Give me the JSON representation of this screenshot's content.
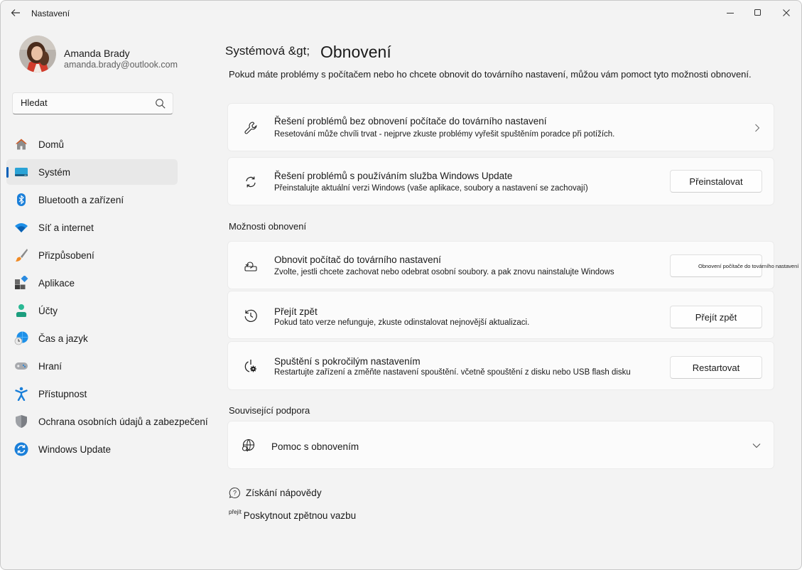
{
  "window": {
    "title": "Nastavení",
    "controls": {
      "minimize": "minimize-icon",
      "maximize": "maximize-icon",
      "close": "close-icon"
    }
  },
  "profile": {
    "name": "Amanda Brady",
    "email": "amanda.brady@outlook.com"
  },
  "search": {
    "placeholder": "Hledat",
    "value": ""
  },
  "sidebar": {
    "items": [
      {
        "label": "Domů",
        "icon": "home-icon",
        "active": false
      },
      {
        "label": "Systém",
        "icon": "system-icon",
        "active": true
      },
      {
        "label": "Bluetooth a zařízení",
        "icon": "bluetooth-icon",
        "active": false
      },
      {
        "label": "Síť a internet",
        "icon": "wifi-icon",
        "active": false
      },
      {
        "label": "Přizpůsobení",
        "icon": "brush-icon",
        "active": false
      },
      {
        "label": "Aplikace",
        "icon": "apps-icon",
        "active": false
      },
      {
        "label": "Účty",
        "icon": "account-icon",
        "active": false
      },
      {
        "label": "Čas a jazyk",
        "icon": "time-language-icon",
        "active": false
      },
      {
        "label": "Hraní",
        "icon": "gaming-icon",
        "active": false
      },
      {
        "label": "Přístupnost",
        "icon": "accessibility-icon",
        "active": false
      },
      {
        "label": "Ochrana osobních údajů a zabezpečení",
        "icon": "shield-icon",
        "active": false
      },
      {
        "label": "Windows Update",
        "icon": "windows-update-icon",
        "active": false
      }
    ]
  },
  "main": {
    "breadcrumb": "Systémová &gt;",
    "title": "Obnovení",
    "intro": "Pokud máte problémy s počítačem nebo ho chcete obnovit do továrního nastavení, můžou vám pomoct tyto možnosti obnovení.",
    "top_cards": [
      {
        "title": "Řešení problémů bez obnovení počítače do továrního nastavení",
        "desc": "Resetování může chvíli trvat - nejprve zkuste problémy vyřešit spuštěním poradce při potížích.",
        "icon": "wrench-icon"
      },
      {
        "title": "Řešení problémů s používáním služba Windows Update",
        "desc": "Přeinstalujte aktuální verzi Windows (vaše aplikace, soubory a nastavení se zachovají)",
        "icon": "sync-icon",
        "button": "Přeinstalovat"
      }
    ],
    "recovery_section": {
      "heading": "Možnosti obnovení",
      "cards": [
        {
          "title": "Obnovit počítač do továrního nastavení",
          "desc": "Zvolte, jestli chcete zachovat nebo odebrat osobní soubory. a pak znovu nainstalujte Windows",
          "icon": "reset-pc-icon",
          "button": "Obnovení počítače do továrního nastavení"
        },
        {
          "title": "Přejít zpět",
          "desc": "Pokud tato verze nefunguje, zkuste odinstalovat nejnovější aktualizaci.",
          "icon": "history-icon",
          "button": "Přejít zpět"
        },
        {
          "title": "Spuštění s pokročilým nastavením",
          "desc": "Restartujte zařízení a změňte nastavení spouštění. včetně spouštění z disku nebo USB flash disku",
          "icon": "advanced-startup-icon",
          "button": "Restartovat"
        }
      ]
    },
    "support_section": {
      "heading": "Související podpora",
      "item": {
        "title": "Pomoc s obnovením",
        "icon": "globe-search-icon",
        "expanded": false
      }
    },
    "links": {
      "help": "Získání nápovědy",
      "feedback_prefix": "přejít",
      "feedback": "Poskytnout zpětnou vazbu"
    }
  }
}
